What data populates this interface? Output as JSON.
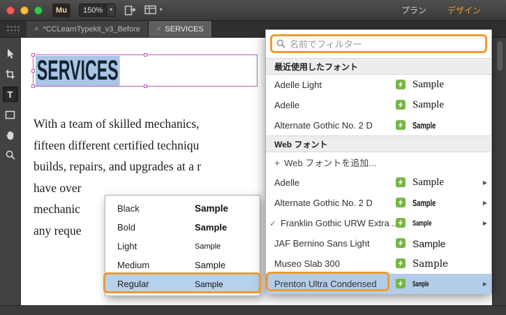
{
  "titlebar": {
    "logo": "Mu",
    "zoom": "150%",
    "plan_label": "プラン",
    "design_label": "デザイン"
  },
  "glyphs": {
    "close": "×",
    "caret": "▼",
    "chevron": "▶",
    "check": "✓",
    "plus": "+"
  },
  "tabs": {
    "items": [
      {
        "label": "*CCLearnTypekit_v3_Before"
      },
      {
        "label": "SERVICES"
      }
    ]
  },
  "canvas": {
    "heading": "SERVICES",
    "body_lines": [
      "With a team of skilled mechanics,",
      "fifteen different certified techniqu",
      "builds, repairs, and upgrades at a r",
      "have over",
      "mechanic",
      "any reque"
    ]
  },
  "weight_menu": {
    "items": [
      {
        "label": "Black",
        "sample": "Sample"
      },
      {
        "label": "Bold",
        "sample": "Sample"
      },
      {
        "label": "Light",
        "sample": "Sample"
      },
      {
        "label": "Medium",
        "sample": "Sample"
      },
      {
        "label": "Regular",
        "sample": "Sample",
        "selected": true
      }
    ]
  },
  "font_panel": {
    "filter_placeholder": "名前でフィルター",
    "recent_header": "最近使用したフォント",
    "web_header": "Web フォント",
    "add_label": "Web フォントを追加...",
    "recent": [
      {
        "name": "Adelle Light",
        "sample": "Sample"
      },
      {
        "name": "Adelle",
        "sample": "Sample"
      },
      {
        "name": "Alternate Gothic No. 2 D",
        "sample": "Sample"
      }
    ],
    "web": [
      {
        "name": "Adelle",
        "sample": "Sample"
      },
      {
        "name": "Alternate Gothic No. 2 D",
        "sample": "Sample"
      },
      {
        "name": "Franklin Gothic URW Extra ...",
        "sample": "Sample",
        "checked": true
      },
      {
        "name": "JAF Bernino Sans Light",
        "sample": "Sample"
      },
      {
        "name": "Museo Slab 300",
        "sample": "Sample"
      },
      {
        "name": "Prenton Ultra Condensed",
        "sample": "Sample",
        "selected": true
      }
    ]
  },
  "colors": {
    "annotation_orange": "#ee9b30",
    "selection_blue": "#b3cde9",
    "typekit_green": "#74b843",
    "design_label_orange": "#f0a030",
    "frame_purple": "#c05ec0",
    "heading_highlight": "#a9c6e6"
  }
}
